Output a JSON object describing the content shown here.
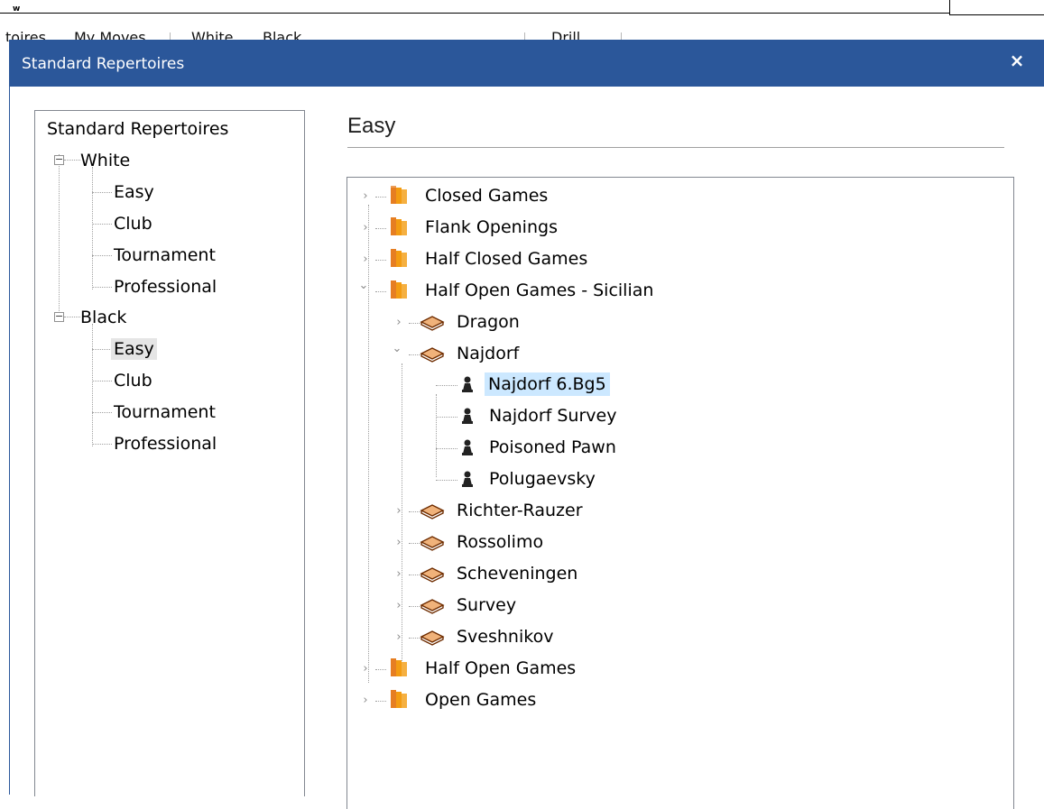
{
  "background_app": {
    "corner_mark": "w",
    "menu_items": [
      "toires",
      "My Moves",
      "White",
      "Black",
      "Drill"
    ]
  },
  "dialog": {
    "title": "Standard Repertoires",
    "close_glyph": "×"
  },
  "left_tree": {
    "root": "Standard Repertoires",
    "white": {
      "label": "White",
      "expander": "−",
      "children": [
        "Easy",
        "Club",
        "Tournament",
        "Professional"
      ]
    },
    "black": {
      "label": "Black",
      "expander": "−",
      "children": [
        "Easy",
        "Club",
        "Tournament",
        "Professional"
      ],
      "selected": "Easy"
    }
  },
  "right": {
    "heading": "Easy",
    "tree": {
      "top": [
        "Closed Games",
        "Flank Openings",
        "Half Closed Games",
        "Half Open Games - Sicilian",
        "Half Open Games",
        "Open Games"
      ],
      "sicilian_children": [
        "Dragon",
        "Najdorf",
        "Richter-Rauzer",
        "Rossolimo",
        "Scheveningen",
        "Survey",
        "Sveshnikov"
      ],
      "najdorf_children": [
        "Najdorf 6.Bg5",
        "Najdorf Survey",
        "Poisoned Pawn",
        "Polugaevsky"
      ],
      "selected": "Najdorf 6.Bg5"
    },
    "chevron_collapsed": "›",
    "chevron_expanded": "⌄"
  },
  "colors": {
    "titlebar": "#2b579a",
    "selection": "#cce8ff",
    "book_orange": "#f39c12",
    "book_open": "#d2691e"
  },
  "icons": {
    "category": "book-stack-icon",
    "opening": "open-book-icon",
    "variation": "pawn-icon",
    "expander": "minus-box-icon"
  }
}
